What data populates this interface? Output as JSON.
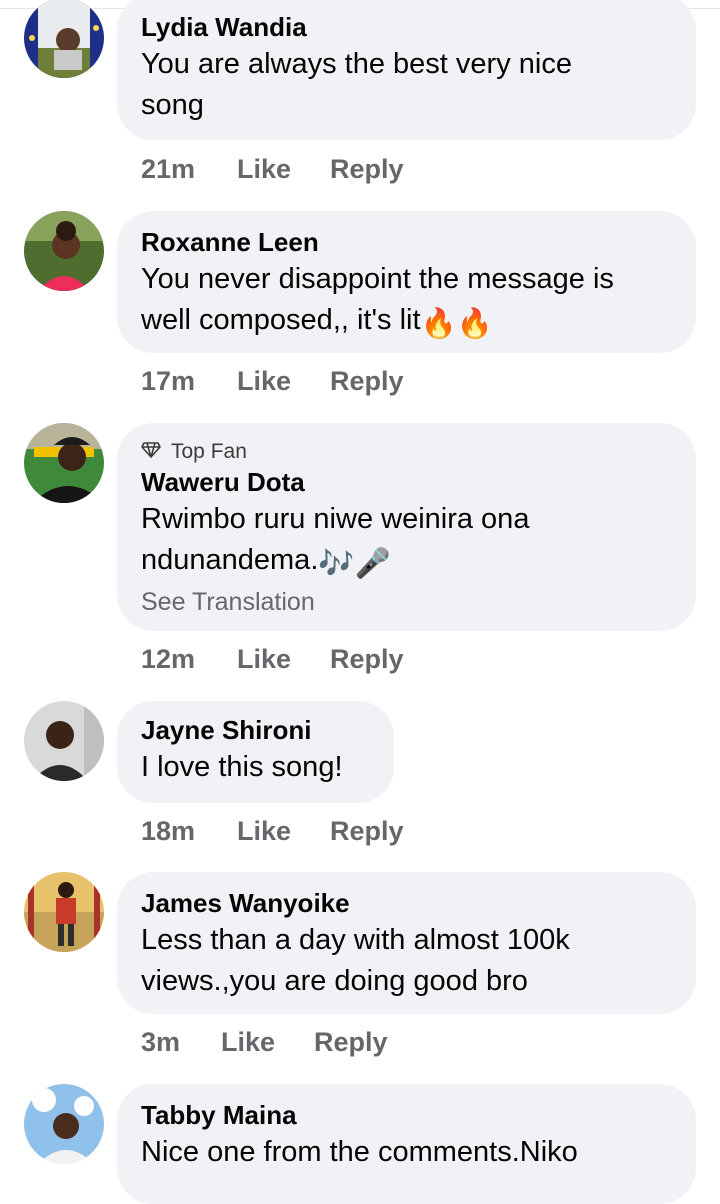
{
  "comments": [
    {
      "author": "Lydia Wandia",
      "lines": [
        "You are always the best very nice",
        "song"
      ],
      "time": "21m",
      "like_label": "Like",
      "reply_label": "Reply"
    },
    {
      "author": "Roxanne Leen",
      "lines": [
        "You never disappoint the message is",
        "well composed,, it's lit"
      ],
      "emoji": "🔥🔥",
      "time": "17m",
      "like_label": "Like",
      "reply_label": "Reply"
    },
    {
      "badge": "Top Fan",
      "author": "Waweru Dota",
      "lines": [
        "Rwimbo ruru niwe weinira ona",
        "ndunandema."
      ],
      "emoji": "🎶🎤",
      "see_translation": "See Translation",
      "time": "12m",
      "like_label": "Like",
      "reply_label": "Reply"
    },
    {
      "author": "Jayne Shironi",
      "lines": [
        "I love this song!"
      ],
      "time": "18m",
      "like_label": "Like",
      "reply_label": "Reply"
    },
    {
      "author": "James Wanyoike",
      "lines": [
        "Less than a day with almost 100k",
        "views.,you are doing good bro"
      ],
      "time": "3m",
      "like_label": "Like",
      "reply_label": "Reply"
    },
    {
      "author": "Tabby Maina",
      "lines": [
        "Nice one from the comments.Niko"
      ]
    }
  ],
  "colors": {
    "bubble": "#f0f2f5",
    "meta": "#65676b",
    "text": "#050505"
  }
}
